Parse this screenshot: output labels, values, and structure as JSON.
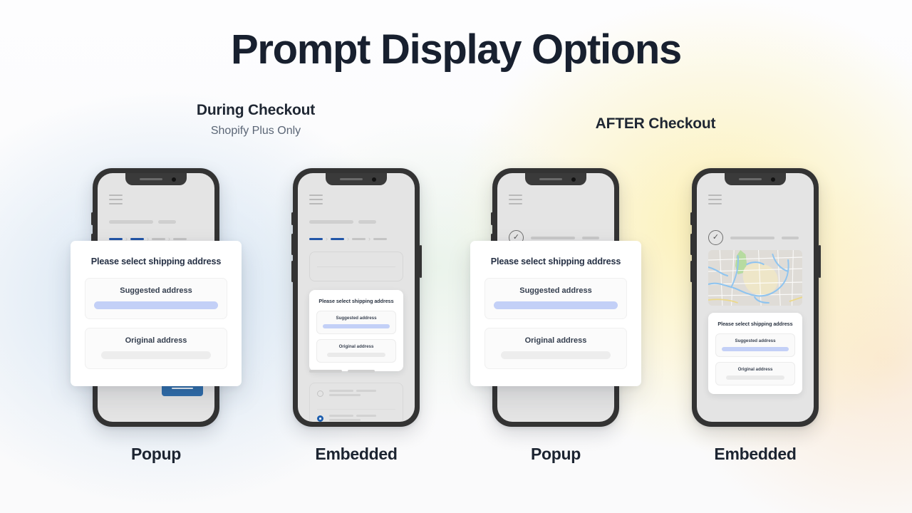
{
  "page": {
    "title": "Prompt Display Options"
  },
  "groups": [
    {
      "title": "During Checkout",
      "subtitle": "Shopify Plus Only"
    },
    {
      "title": "AFTER Checkout",
      "subtitle": ""
    }
  ],
  "prompt": {
    "title": "Please select shipping address",
    "options": [
      {
        "label": "Suggested address",
        "state": "suggested"
      },
      {
        "label": "Original address",
        "state": "original"
      }
    ]
  },
  "phones": [
    {
      "id": "during-popup",
      "caption": "Popup",
      "mode": "popup",
      "stage": "during"
    },
    {
      "id": "during-embedded",
      "caption": "Embedded",
      "mode": "embedded",
      "stage": "during"
    },
    {
      "id": "after-popup",
      "caption": "Popup",
      "mode": "popup",
      "stage": "after"
    },
    {
      "id": "after-embedded",
      "caption": "Embedded",
      "mode": "embedded",
      "stage": "after"
    }
  ],
  "icons": {
    "hamburger": "hamburger-menu-icon",
    "check": "check-circle-icon",
    "chevron": "chevron-right-icon",
    "camera": "front-camera-icon",
    "speaker": "earpiece-speaker-icon",
    "map": "map-thumbnail-icon"
  },
  "glyphs": {
    "chevron": "›",
    "check": "✓"
  },
  "colors": {
    "accent_blue": "#2f6daa",
    "breadcrumb_active": "#2256a8",
    "suggested_bar": "#c3d0f7",
    "original_bar": "#ededed",
    "phone_frame": "#333333",
    "screen_bg": "#e4e4e4",
    "title_text": "#18202f"
  }
}
